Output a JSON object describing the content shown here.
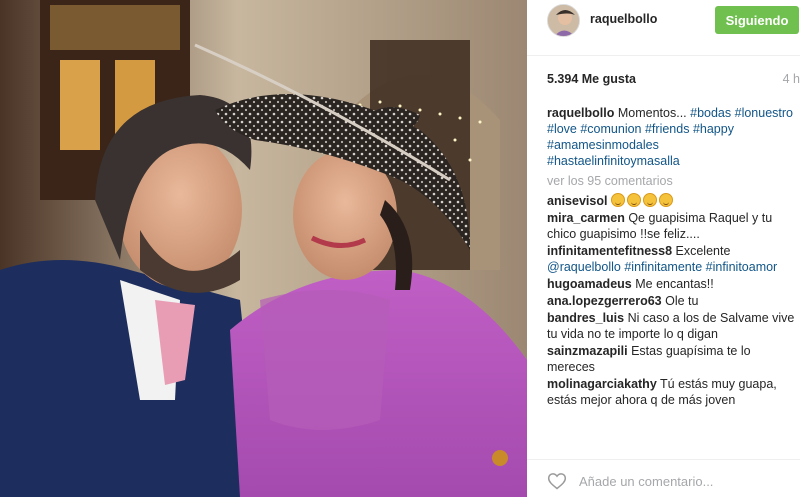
{
  "post": {
    "username": "raquelbollo",
    "follow_label": "Siguiendo",
    "likes": "5.394 Me gusta",
    "time": "4 h"
  },
  "caption": {
    "user": "raquelbollo",
    "text": "Momentos...",
    "tags_line1": "#bodas",
    "tags_line2": "#lonuestro #love #comunion #friends",
    "tags_line3": "#happy #amamesinmodales",
    "tags_line4": "#hastaelinfinitoymasalla"
  },
  "view_more": "ver los 95 comentarios",
  "comments": [
    {
      "user": "anisevisol",
      "text": ""
    },
    {
      "user": "mira_carmen",
      "text": "Qe guapisima Raquel y tu chico guapisimo !!se feliz...."
    },
    {
      "user": "infinitamentefitness8",
      "text": "Excelente",
      "tag1": "@raquelbollo",
      "tag2": "#infinitamente",
      "tag3": "#infinitoamor"
    },
    {
      "user": "hugoamadeus",
      "text": "Me encantas!!"
    },
    {
      "user": "ana.lopezgerrero63",
      "text": "Ole tu"
    },
    {
      "user": "bandres_luis",
      "text": "Ni caso a los de Salvame vive tu vida no te importe lo q digan"
    },
    {
      "user": "sainzmazapili",
      "text": "Estas guapísima te lo mereces"
    },
    {
      "user": "molinagarciakathy",
      "text": "Tú estás muy guapa, estás mejor ahora q de más joven"
    }
  ],
  "footer": {
    "placeholder": "Añade un comentario..."
  },
  "icons": {
    "like": "heart-icon",
    "emoji": "grinning-face-emoji"
  },
  "colors": {
    "follow_bg": "#70c050",
    "link": "#125688",
    "muted": "#a5a7aa"
  }
}
